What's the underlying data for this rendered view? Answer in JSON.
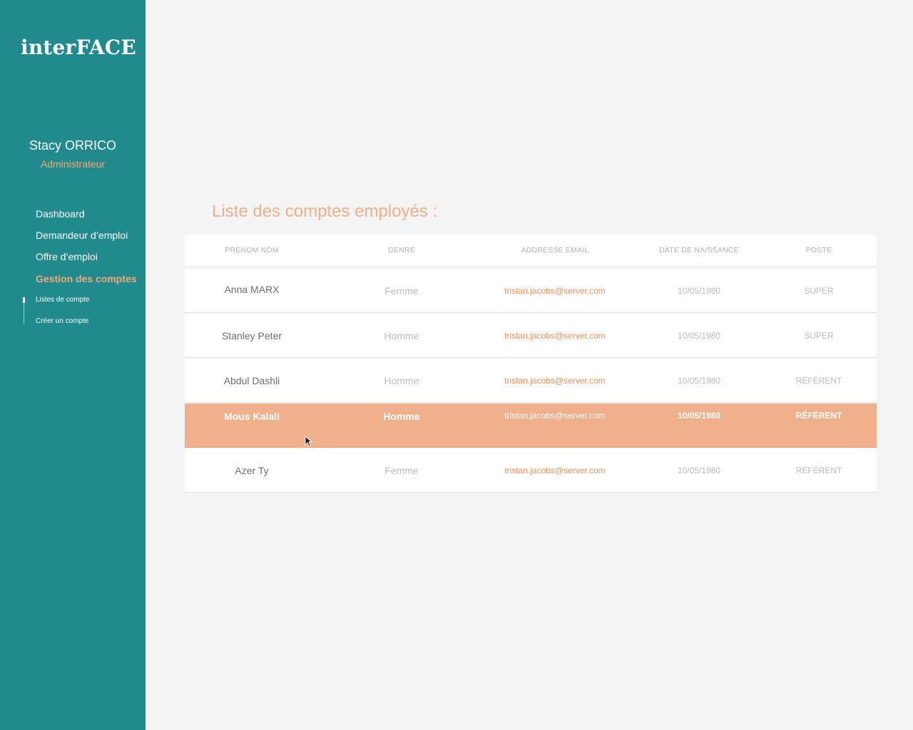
{
  "app": {
    "logo": "interFACE"
  },
  "user": {
    "name": "Stacy ORRICO",
    "role": "Administrateur"
  },
  "nav": {
    "items": [
      "Dashboard",
      "Demandeur d’emploi",
      "Offre d’emploi",
      "Gestion des comptes"
    ],
    "active": "Gestion des comptes",
    "subitems": [
      "Listes de compte",
      "Créer un compte"
    ]
  },
  "main": {
    "title": "Liste des comptes employés :"
  },
  "table": {
    "headers": [
      "PRENOM NOM",
      "GENRE",
      "ADDRESSE EMAIL",
      "DATE DE NAISSANCE",
      "POSTE"
    ],
    "rows": [
      {
        "name": "Anna  MARX",
        "genre": "Femme",
        "email": "tristan.jacobs@server.com",
        "dob": "10/05/1980",
        "poste": "SUPER"
      },
      {
        "name": "Stanley  Peter",
        "genre": "Homme",
        "email": "tristan.jacobs@server.com",
        "dob": "10/05/1980",
        "poste": "SUPER"
      },
      {
        "name": "Abdul Dashli",
        "genre": "Homme",
        "email": "tristan.jacobs@server.com",
        "dob": "10/05/1980",
        "poste": "RÉFÉRENT"
      },
      {
        "name": "Mous  Kalali",
        "genre": "Homme",
        "email": "tristan.jacobs@server.com",
        "dob": "10/05/1980",
        "poste": "RÉFÉRENT",
        "selected": true
      },
      {
        "name": "Azer  Ty",
        "genre": "Femme",
        "email": "tristan.jacobs@server.com",
        "dob": "10/05/1980",
        "poste": "RÉFÉRENT"
      }
    ]
  },
  "colors": {
    "sidebar": "#218a8c",
    "accent": "#f1a874",
    "selected_row": "#f1b08c",
    "background": "#f4f4f4"
  },
  "icons": {
    "cursor": "mouse-pointer-icon"
  }
}
